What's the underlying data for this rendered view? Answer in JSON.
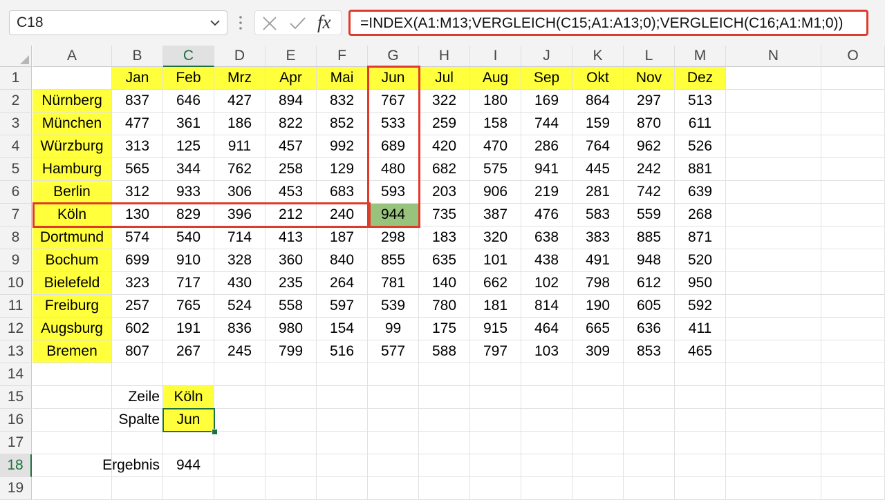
{
  "formula_bar": {
    "name_box": "C18",
    "formula": "=INDEX(A1:M13;VERGLEICH(C15;A1:A13;0);VERGLEICH(C16;A1:M1;0))",
    "icons": [
      "chevron-down-icon",
      "vertical-dots-icon",
      "cancel-x-icon",
      "check-icon",
      "fx-icon"
    ]
  },
  "columns": [
    "A",
    "B",
    "C",
    "D",
    "E",
    "F",
    "G",
    "H",
    "I",
    "J",
    "K",
    "L",
    "M",
    "N",
    "O"
  ],
  "rows": [
    "1",
    "2",
    "3",
    "4",
    "5",
    "6",
    "7",
    "8",
    "9",
    "10",
    "11",
    "12",
    "13",
    "14",
    "15",
    "16",
    "17",
    "18",
    "19"
  ],
  "months": [
    "Jan",
    "Feb",
    "Mrz",
    "Apr",
    "Mai",
    "Jun",
    "Jul",
    "Aug",
    "Sep",
    "Okt",
    "Nov",
    "Dez"
  ],
  "table": [
    {
      "city": "Nürnberg",
      "values": [
        "837",
        "646",
        "427",
        "894",
        "832",
        "767",
        "322",
        "180",
        "169",
        "864",
        "297",
        "513"
      ]
    },
    {
      "city": "München",
      "values": [
        "477",
        "361",
        "186",
        "822",
        "852",
        "533",
        "259",
        "158",
        "744",
        "159",
        "870",
        "611"
      ]
    },
    {
      "city": "Würzburg",
      "values": [
        "313",
        "125",
        "911",
        "457",
        "992",
        "689",
        "420",
        "470",
        "286",
        "764",
        "962",
        "526"
      ]
    },
    {
      "city": "Hamburg",
      "values": [
        "565",
        "344",
        "762",
        "258",
        "129",
        "480",
        "682",
        "575",
        "941",
        "445",
        "242",
        "881"
      ]
    },
    {
      "city": "Berlin",
      "values": [
        "312",
        "933",
        "306",
        "453",
        "683",
        "593",
        "203",
        "906",
        "219",
        "281",
        "742",
        "639"
      ]
    },
    {
      "city": "Köln",
      "values": [
        "130",
        "829",
        "396",
        "212",
        "240",
        "944",
        "735",
        "387",
        "476",
        "583",
        "559",
        "268"
      ]
    },
    {
      "city": "Dortmund",
      "values": [
        "574",
        "540",
        "714",
        "413",
        "187",
        "298",
        "183",
        "320",
        "638",
        "383",
        "885",
        "871"
      ]
    },
    {
      "city": "Bochum",
      "values": [
        "699",
        "910",
        "328",
        "360",
        "840",
        "855",
        "635",
        "101",
        "438",
        "491",
        "948",
        "520"
      ]
    },
    {
      "city": "Bielefeld",
      "values": [
        "323",
        "717",
        "430",
        "235",
        "264",
        "781",
        "140",
        "662",
        "102",
        "798",
        "612",
        "950"
      ]
    },
    {
      "city": "Freiburg",
      "values": [
        "257",
        "765",
        "524",
        "558",
        "597",
        "539",
        "780",
        "181",
        "814",
        "190",
        "605",
        "592"
      ]
    },
    {
      "city": "Augsburg",
      "values": [
        "602",
        "191",
        "836",
        "980",
        "154",
        "99",
        "175",
        "915",
        "464",
        "665",
        "636",
        "411"
      ]
    },
    {
      "city": "Bremen",
      "values": [
        "807",
        "267",
        "245",
        "799",
        "516",
        "577",
        "588",
        "797",
        "103",
        "309",
        "853",
        "465"
      ]
    }
  ],
  "lookup": {
    "row_label": "Zeile",
    "row_value": "Köln",
    "col_label": "Spalte",
    "col_value": "Jun",
    "result_label": "Ergebnis",
    "result_value": "944"
  },
  "selected_cell": "C18",
  "colors": {
    "highlight_yellow": "#ffff3c",
    "result_green": "#97c37c",
    "annotation_red": "#e03a2a",
    "excel_green": "#1e7145"
  }
}
